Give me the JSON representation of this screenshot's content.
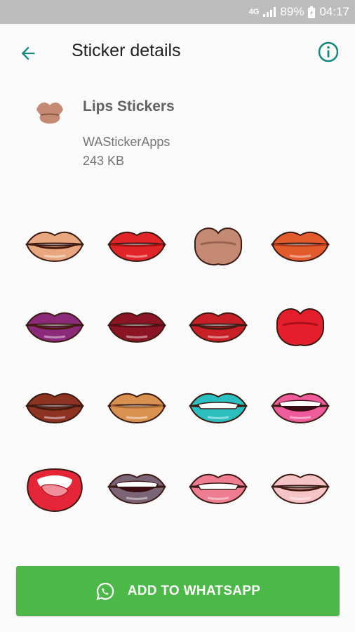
{
  "status_bar": {
    "network": "4G",
    "battery": "89%",
    "time": "04:17"
  },
  "app_bar": {
    "title": "Sticker details",
    "back_icon": "arrow-back-icon",
    "info_icon": "info-icon"
  },
  "pack": {
    "name": "Lips Stickers",
    "author": "WAStickerApps",
    "size": "243 KB"
  },
  "stickers": [
    {
      "lip": "#e9a77f",
      "dark": "#c97a57",
      "style": "smile"
    },
    {
      "lip": "#e12427",
      "dark": "#a81215",
      "style": "closed"
    },
    {
      "lip": "#c58a74",
      "dark": "#9a6150",
      "style": "pucker"
    },
    {
      "lip": "#e35a2c",
      "dark": "#b43c18",
      "style": "closed"
    },
    {
      "lip": "#8c2a7a",
      "dark": "#5e1552",
      "style": "smile"
    },
    {
      "lip": "#8b1524",
      "dark": "#5c0a16",
      "style": "closed"
    },
    {
      "lip": "#c81f26",
      "dark": "#8e1016",
      "style": "smile"
    },
    {
      "lip": "#e51e2b",
      "dark": "#a9101a",
      "style": "pucker"
    },
    {
      "lip": "#8e3221",
      "dark": "#5d1c11",
      "style": "smile"
    },
    {
      "lip": "#d99150",
      "dark": "#ad6a30",
      "style": "closed"
    },
    {
      "lip": "#2bbfc0",
      "dark": "#17898a",
      "style": "bite"
    },
    {
      "lip": "#ee5c9b",
      "dark": "#c1356f",
      "style": "open"
    },
    {
      "lip": "#e42638",
      "dark": "#a6121f",
      "style": "tongue"
    },
    {
      "lip": "#7b6476",
      "dark": "#4f3d4b",
      "style": "open"
    },
    {
      "lip": "#ef7d92",
      "dark": "#c85569",
      "style": "bite"
    },
    {
      "lip": "#f6c3c6",
      "dark": "#d9979c",
      "style": "smile"
    }
  ],
  "button": {
    "label": "ADD TO WHATSAPP",
    "icon": "whatsapp-icon",
    "color": "#4cb848"
  }
}
